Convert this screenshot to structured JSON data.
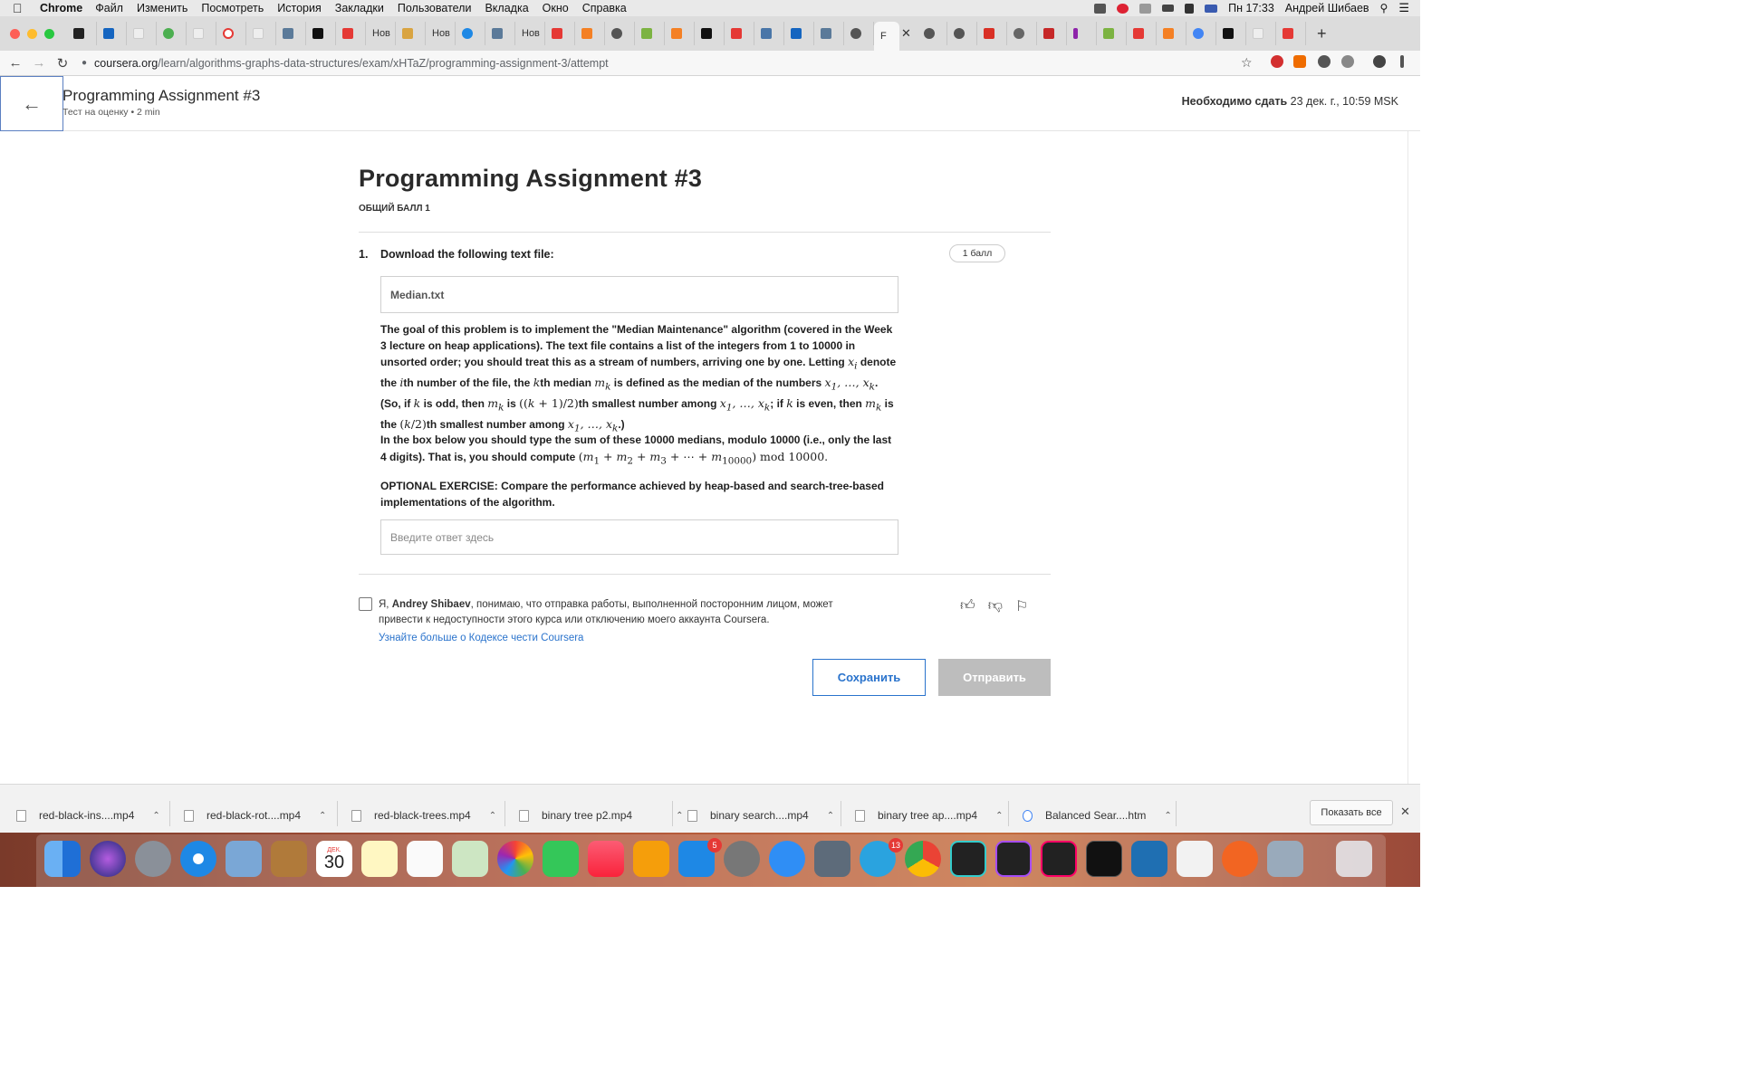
{
  "menubar": {
    "app": "Chrome",
    "items": [
      "Файл",
      "Изменить",
      "Посмотреть",
      "История",
      "Закладки",
      "Пользователи",
      "Вкладка",
      "Окно",
      "Справка"
    ],
    "clock": "Пн 17:33",
    "user": "Андрей Шибаев"
  },
  "tabs": {
    "labels": [
      "Нов",
      "Нов",
      "Нов"
    ],
    "active_label": "F"
  },
  "address": {
    "host": "coursera.org",
    "path": "/learn/algorithms-graphs-data-structures/exam/xHTaZ/programming-assignment-3/attempt"
  },
  "header": {
    "title": "Programming Assignment #3",
    "subtitle": "Тест на оценку • 2 min",
    "due_label": "Необходимо сдать",
    "due_value": "23 дек. г., 10:59 MSK"
  },
  "quiz": {
    "title": "Programming Assignment #3",
    "total": "ОБЩИЙ БАЛЛ 1",
    "question_number": "1.",
    "question_prompt": "Download the following text file:",
    "points": "1 балл",
    "file_link": "Median.txt",
    "answer_placeholder": "Введите ответ здесь"
  },
  "honor": {
    "prefix": "Я, ",
    "name": "Andrey Shibaev",
    "text": ", понимаю, что отправка работы, выполненной посторонним лицом, может привести к недоступности этого курса или отключению моего аккаунта Coursera.",
    "link": "Узнайте больше о Кодексе чести Coursera"
  },
  "buttons": {
    "save": "Сохранить",
    "submit": "Отправить"
  },
  "downloads": {
    "items": [
      "red-black-ins....mp4",
      "red-black-rot....mp4",
      "red-black-trees.mp4",
      "binary tree p2.mp4",
      "binary search....mp4",
      "binary tree ap....mp4",
      "Balanced Sear....htm"
    ],
    "show_all": "Показать все"
  },
  "dock": {
    "calendar_month": "ДЕК.",
    "calendar_day": "30",
    "badges": [
      "5",
      "13"
    ]
  },
  "colors": {
    "accent": "#2a73cc",
    "submit_disabled": "#bdbdbd"
  }
}
